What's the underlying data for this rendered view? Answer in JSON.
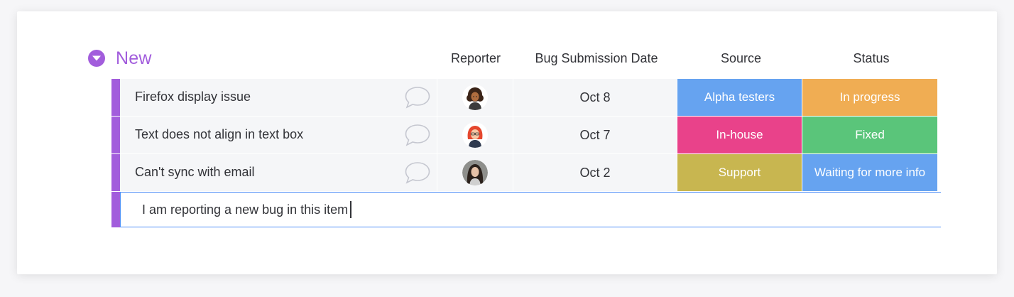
{
  "group": {
    "title": "New",
    "accent_color": "#a25ddc"
  },
  "columns": {
    "reporter": "Reporter",
    "date": "Bug Submission Date",
    "source": "Source",
    "status": "Status"
  },
  "rows": [
    {
      "name": "Firefox display issue",
      "reporter_avatar": "avatar-woman-curly-hair",
      "date": "Oct 8",
      "source": "Alpha testers",
      "source_color": "#66a3f0",
      "status": "In progress",
      "status_color": "#f0ad53"
    },
    {
      "name": "Text does not align in text box",
      "reporter_avatar": "avatar-woman-red-hair",
      "date": "Oct 7",
      "source": "In-house",
      "source_color": "#e9428a",
      "status": "Fixed",
      "status_color": "#5ac57a"
    },
    {
      "name": "Can't sync with email",
      "reporter_avatar": "avatar-woman-photo",
      "date": "Oct 2",
      "source": "Support",
      "source_color": "#c8b650",
      "status": "Waiting for more info",
      "status_color": "#66a3f0"
    }
  ],
  "new_item": {
    "value": "I am reporting a new bug in this item"
  }
}
